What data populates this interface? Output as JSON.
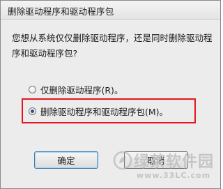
{
  "window": {
    "title": "删除驱动程序和驱动程序包"
  },
  "message": {
    "line1": "您想从系统仅仅删除驱动程序，还是同时删除驱动程",
    "line2": "序和驱动程序包?"
  },
  "options": [
    {
      "label": "仅删除驱动程序(R)。",
      "selected": false
    },
    {
      "label": "删除驱动程序和驱动程序包(M)。",
      "selected": true
    }
  ],
  "buttons": {
    "ok_label": "确定",
    "cancel_label": "取消"
  },
  "highlight": {
    "color": "#e3171d"
  },
  "watermark": {
    "name": "绿茶软件园",
    "url": "www.33LC.com"
  }
}
